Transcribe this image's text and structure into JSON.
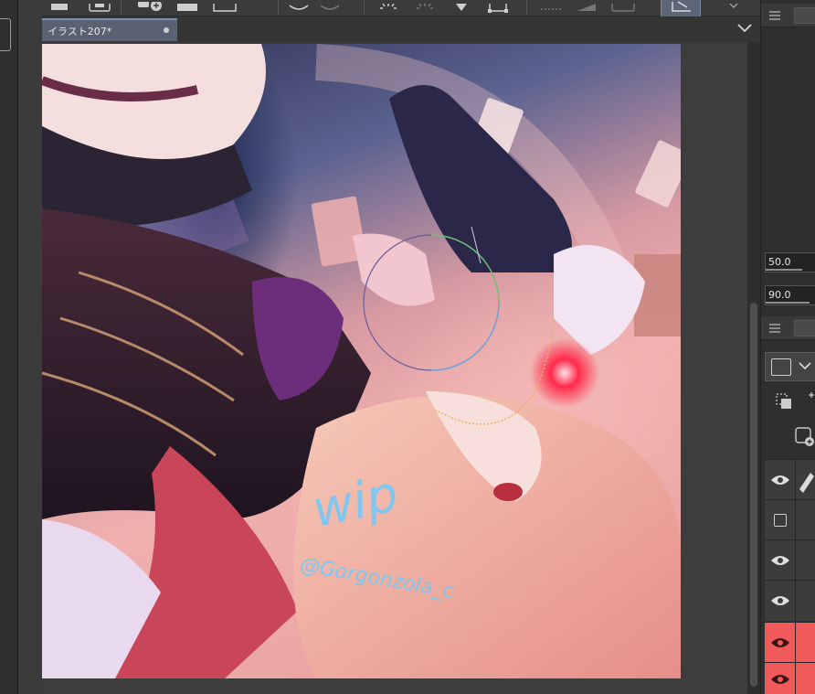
{
  "document": {
    "tab_title": "イラスト207*"
  },
  "watermark": {
    "label": "wip",
    "handle": "@Gorgonzola_c"
  },
  "tool_property": {
    "field_1_value": "50.0",
    "field_2_value": "90.0"
  },
  "colors": {
    "tab_active": "#5a6172",
    "toolbar_active": "#5c6678",
    "layer_highlight": "#f05a5a",
    "watermark": "#7fc6f0"
  },
  "icons": {
    "toolbar": [
      "new-layer-icon",
      "add-icon",
      "folder-icon",
      "rectangle-icon",
      "undo-icon",
      "redo-icon",
      "brightness-icon",
      "sparkle-icon",
      "fill-icon",
      "transform-icon",
      "grid-icon",
      "ruler-icon",
      "keyboard-icon",
      "edit-icon"
    ]
  }
}
